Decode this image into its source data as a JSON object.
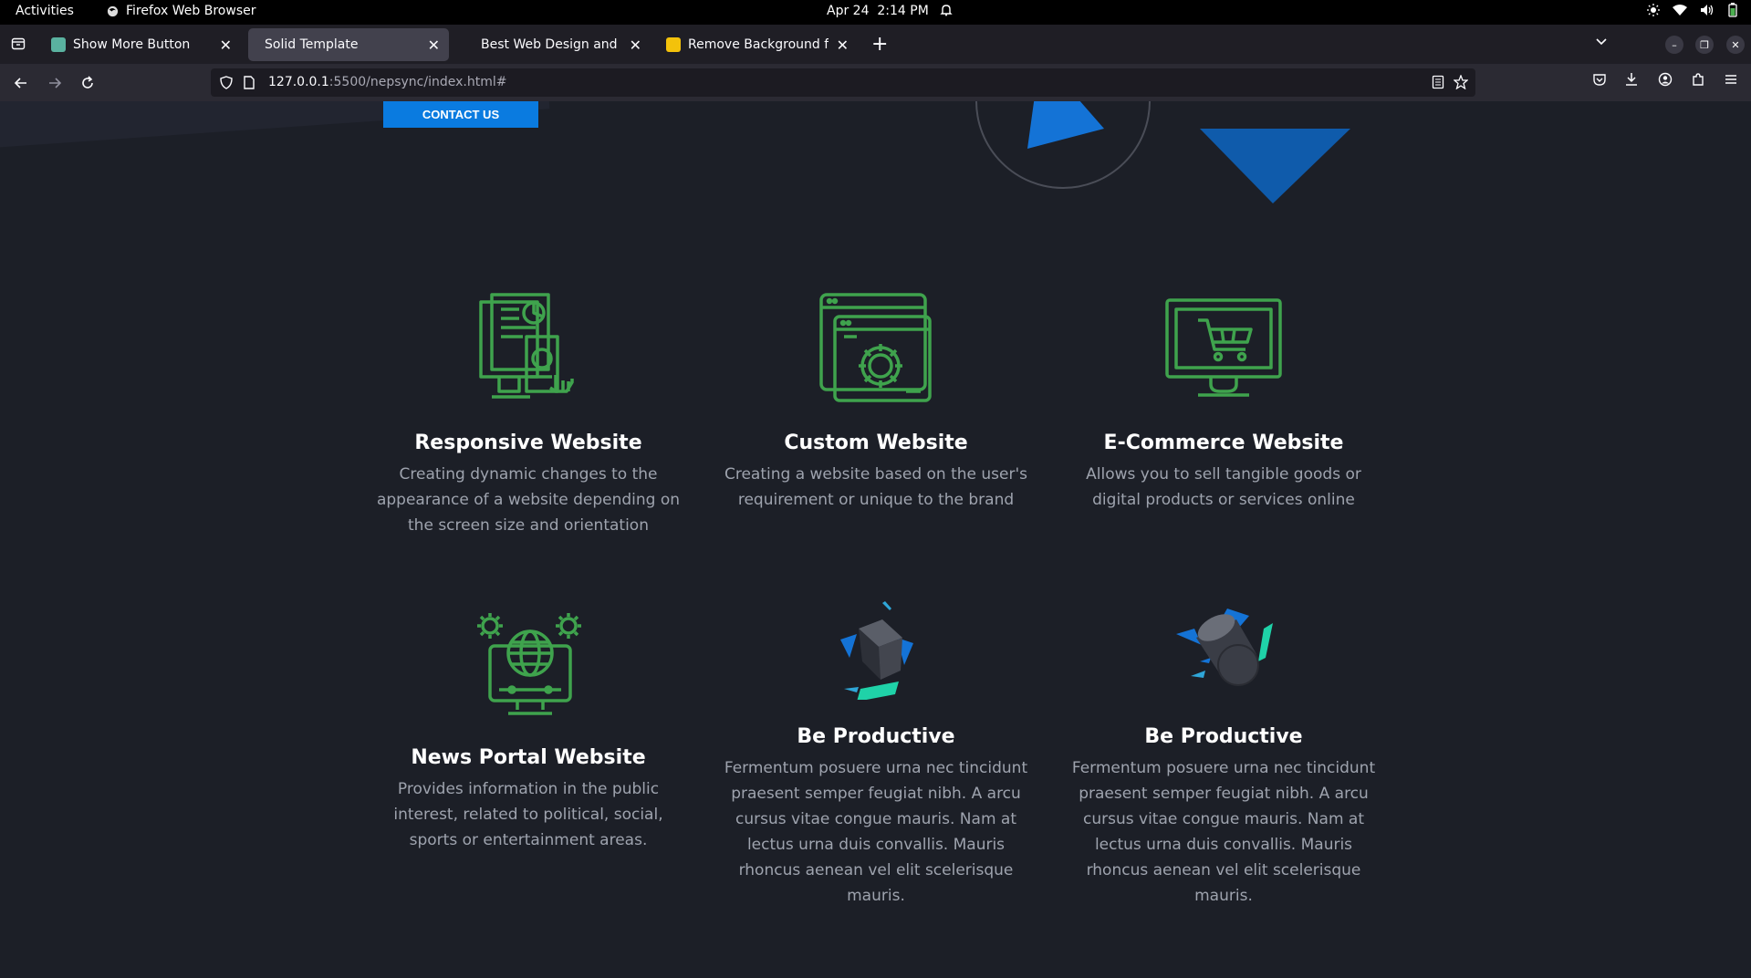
{
  "system": {
    "activities": "Activities",
    "app_name": "Firefox Web Browser",
    "date": "Apr 24",
    "time": "2:14 PM"
  },
  "browser": {
    "tabs": [
      {
        "label": "Show More Button",
        "active": false
      },
      {
        "label": "Solid Template",
        "active": true
      },
      {
        "label": "Best Web Design and Re",
        "active": false
      },
      {
        "label": "Remove Background fron",
        "active": false
      }
    ],
    "url_host": "127.0.0.1",
    "url_path": ":5500/nepsync/index.html#"
  },
  "page": {
    "contact_button": "CONTACT US",
    "services": [
      {
        "title": "Responsive Website",
        "text": "Creating dynamic changes to the appearance of a website depending on the screen size and orientation",
        "icon": "responsive-website-icon"
      },
      {
        "title": "Custom Website",
        "text": "Creating a website based on the user's requirement or unique to the brand",
        "icon": "custom-website-gear-icon"
      },
      {
        "title": "E-Commerce Website",
        "text": "Allows you to sell tangible goods or digital products or services online",
        "icon": "ecommerce-cart-monitor-icon"
      },
      {
        "title": "News Portal Website",
        "text": "Provides information in the public interest, related to political, social, sports or entertainment areas.",
        "icon": "news-portal-globe-icon"
      },
      {
        "title": "Be Productive",
        "text": "Fermentum posuere urna nec tincidunt praesent semper feugiat nibh. A arcu cursus vitae congue mauris. Nam at lectus urna duis convallis. Mauris rhoncus aenean vel elit scelerisque mauris.",
        "icon": "cube-3d-icon"
      },
      {
        "title": "Be Productive",
        "text": "Fermentum posuere urna nec tincidunt praesent semper feugiat nibh. A arcu cursus vitae congue mauris. Nam at lectus urna duis convallis. Mauris rhoncus aenean vel elit scelerisque mauris.",
        "icon": "cylinder-3d-icon"
      }
    ]
  },
  "colors": {
    "accent_green": "#3fa34d",
    "button_blue": "#0a7be0",
    "page_bg": "#1c1f27"
  }
}
